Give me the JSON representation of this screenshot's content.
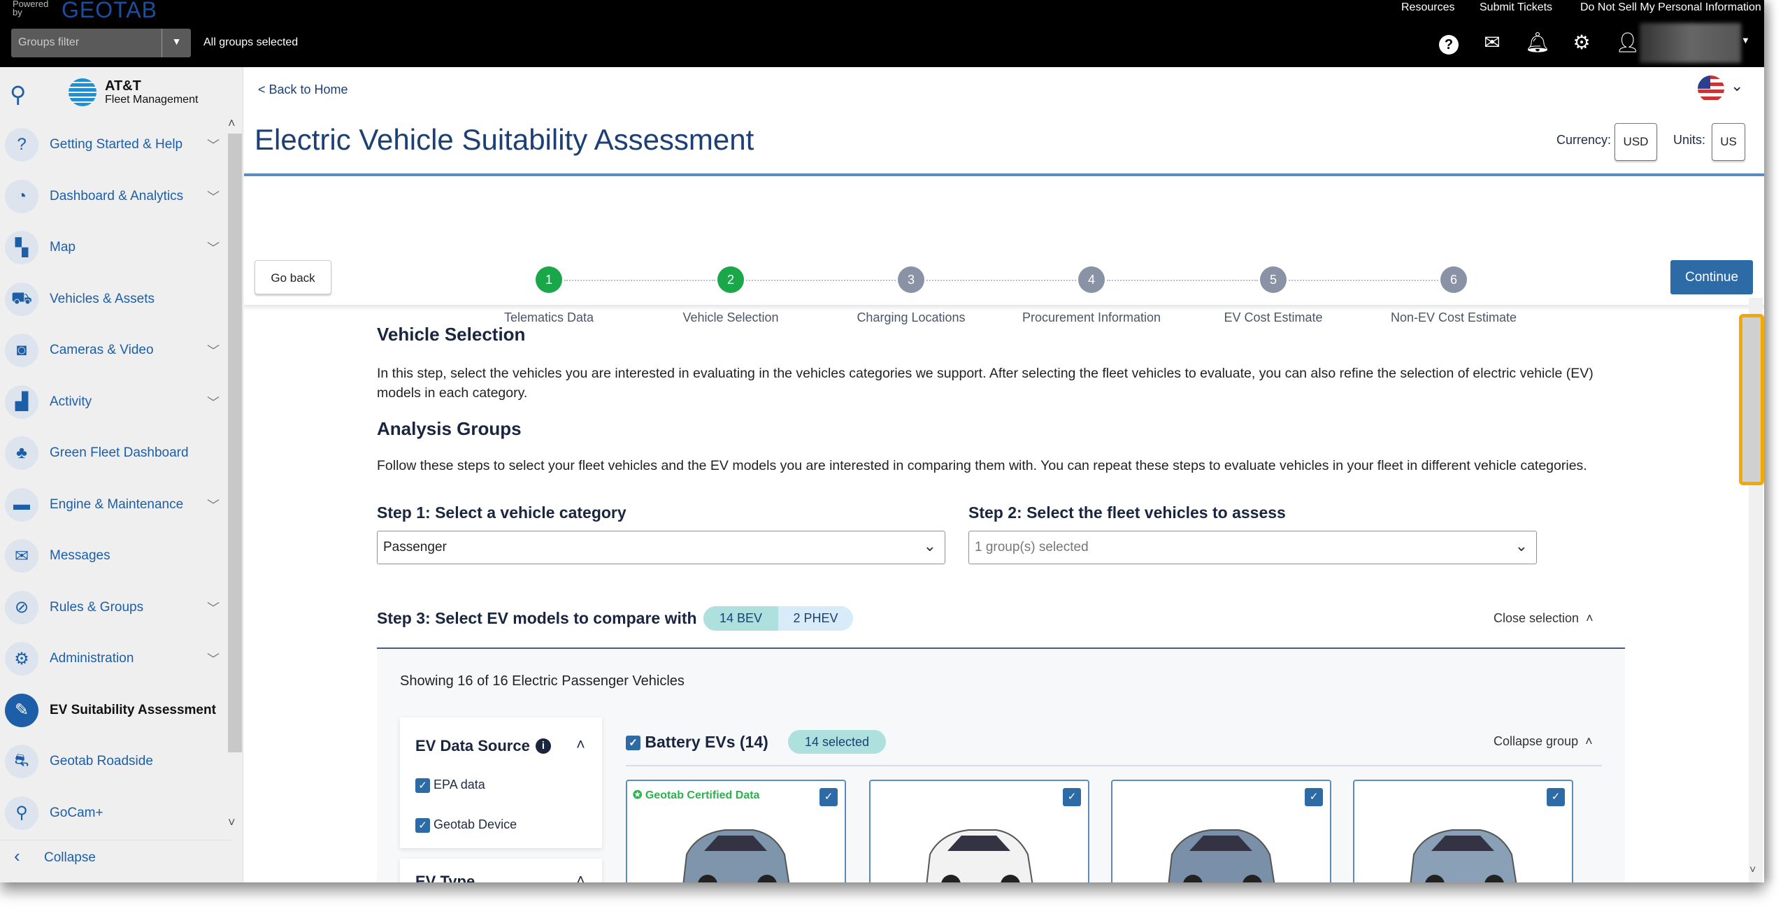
{
  "topbar": {
    "powered_by": "Powered by",
    "brand": "GEOTAB",
    "groups_filter_placeholder": "Groups filter",
    "groups_selected": "All groups selected",
    "links": [
      "Resources",
      "Submit Tickets",
      "Do Not Sell My Personal Information"
    ]
  },
  "sidebar": {
    "logo_line1": "AT&T",
    "logo_line2": "Fleet Management",
    "collapse": "Collapse",
    "items": [
      {
        "label": "Getting Started & Help",
        "icon": "?",
        "expandable": true
      },
      {
        "label": "Dashboard & Analytics",
        "icon": "◔",
        "expandable": true
      },
      {
        "label": "Map",
        "icon": "▚",
        "expandable": true
      },
      {
        "label": "Vehicles & Assets",
        "icon": "⛟",
        "expandable": false
      },
      {
        "label": "Cameras & Video",
        "icon": "◙",
        "expandable": true
      },
      {
        "label": "Activity",
        "icon": "▟",
        "expandable": true
      },
      {
        "label": "Green Fleet Dashboard",
        "icon": "♣",
        "expandable": false
      },
      {
        "label": "Engine & Maintenance",
        "icon": "▬",
        "expandable": true
      },
      {
        "label": "Messages",
        "icon": "✉",
        "expandable": false
      },
      {
        "label": "Rules & Groups",
        "icon": "⊘",
        "expandable": true
      },
      {
        "label": "Administration",
        "icon": "⚙",
        "expandable": true
      },
      {
        "label": "EV Suitability Assessment",
        "icon": "✎",
        "expandable": false,
        "active": true
      },
      {
        "label": "Geotab Roadside",
        "icon": "⛐",
        "expandable": false
      },
      {
        "label": "GoCam+",
        "icon": "⚲",
        "expandable": false
      }
    ]
  },
  "header": {
    "back": "< Back to Home",
    "title": "Electric Vehicle Suitability Assessment",
    "currency_label": "Currency:",
    "currency": "USD",
    "units_label": "Units:",
    "units": "US"
  },
  "stepper": {
    "steps": [
      {
        "n": "1",
        "label": "Telematics Data",
        "done": true
      },
      {
        "n": "2",
        "label": "Vehicle Selection",
        "done": true
      },
      {
        "n": "3",
        "label": "Charging Locations",
        "done": false
      },
      {
        "n": "4",
        "label": "Procurement Information",
        "done": false
      },
      {
        "n": "5",
        "label": "EV Cost Estimate",
        "done": false
      },
      {
        "n": "6",
        "label": "Non-EV Cost Estimate",
        "done": false
      }
    ],
    "go_back": "Go back",
    "continue": "Continue"
  },
  "content": {
    "heading": "Vehicle Selection",
    "intro": "In this step, select the vehicles you are interested in evaluating in the vehicles categories we support. After selecting the fleet vehicles to evaluate, you can also refine the selection of electric vehicle (EV) models in each category.",
    "analysis_heading": "Analysis Groups",
    "analysis_text": "Follow these steps to select your fleet vehicles and the EV models you are interested in comparing them with. You can repeat these steps to evaluate vehicles in your fleet in different vehicle categories.",
    "step1_label": "Step 1: Select a vehicle category",
    "step1_value": "Passenger",
    "step2_label": "Step 2: Select the fleet vehicles to assess",
    "step2_value": "1 group(s) selected",
    "step3_label": "Step 3: Select EV models to compare with",
    "bev_pill": "14 BEV",
    "phev_pill": "2 PHEV",
    "close_selection": "Close selection",
    "showing": "Showing 16 of 16 Electric Passenger Vehicles",
    "filters": {
      "data_source_title": "EV Data Source",
      "options": [
        {
          "label": "EPA data",
          "checked": true
        },
        {
          "label": "Geotab Device",
          "checked": true
        }
      ],
      "ev_type_title": "EV Type"
    },
    "group": {
      "title": "Battery EVs (14)",
      "selected": "14 selected",
      "collapse": "Collapse group"
    },
    "cards": [
      {
        "badge": "Geotab Certified Data",
        "color": "#7f95ab"
      },
      {
        "badge": "",
        "color": "#f2f2f2"
      },
      {
        "badge": "",
        "color": "#7a90a8"
      },
      {
        "badge": "",
        "color": "#8aa0b6"
      }
    ]
  },
  "colors": {
    "accent": "#2d6ba7",
    "done": "#1aa74a",
    "pending": "#8a93a6",
    "scroll_highlight": "#f5a800"
  }
}
